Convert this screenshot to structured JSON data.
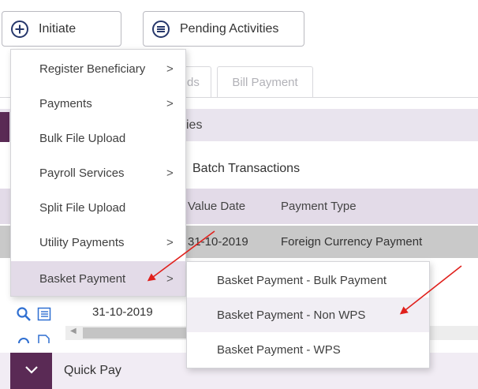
{
  "toolbar": {
    "initiate_label": "Initiate",
    "pending_label": "Pending Activities"
  },
  "tabs": [
    "ds",
    "Bill Payment"
  ],
  "section": {
    "activities_title_fragment": "ies",
    "batch_title": "Batch Transactions"
  },
  "table": {
    "headers": [
      "Value Date",
      "Payment Type"
    ],
    "rows": [
      {
        "value_date": "31-10-2019",
        "payment_type": "Foreign Currency Payment"
      },
      {
        "value_date": "31-10-2019",
        "payment_type": ""
      }
    ]
  },
  "menu": {
    "items": [
      {
        "label": "Register Beneficiary",
        "chevron": ">"
      },
      {
        "label": "Payments",
        "chevron": ">"
      },
      {
        "label": "Bulk File Upload",
        "chevron": ""
      },
      {
        "label": "Payroll Services",
        "chevron": ">"
      },
      {
        "label": "Split File Upload",
        "chevron": ""
      },
      {
        "label": "Utility Payments",
        "chevron": ">"
      },
      {
        "label": "Basket Payment",
        "chevron": ">"
      }
    ]
  },
  "submenu": {
    "items": [
      {
        "label": "Basket Payment - Bulk Payment"
      },
      {
        "label": "Basket Payment - Non WPS"
      },
      {
        "label": "Basket Payment - WPS"
      }
    ]
  },
  "quick_pay": {
    "label": "Quick Pay"
  },
  "colors": {
    "accent_dark": "#5a2a55",
    "header_band": "#e3dbe8",
    "arrow_red": "#e0201c"
  },
  "icons": [
    "plus-circle-icon",
    "list-circle-icon",
    "search-icon",
    "list-icon",
    "chevron-down-icon"
  ]
}
